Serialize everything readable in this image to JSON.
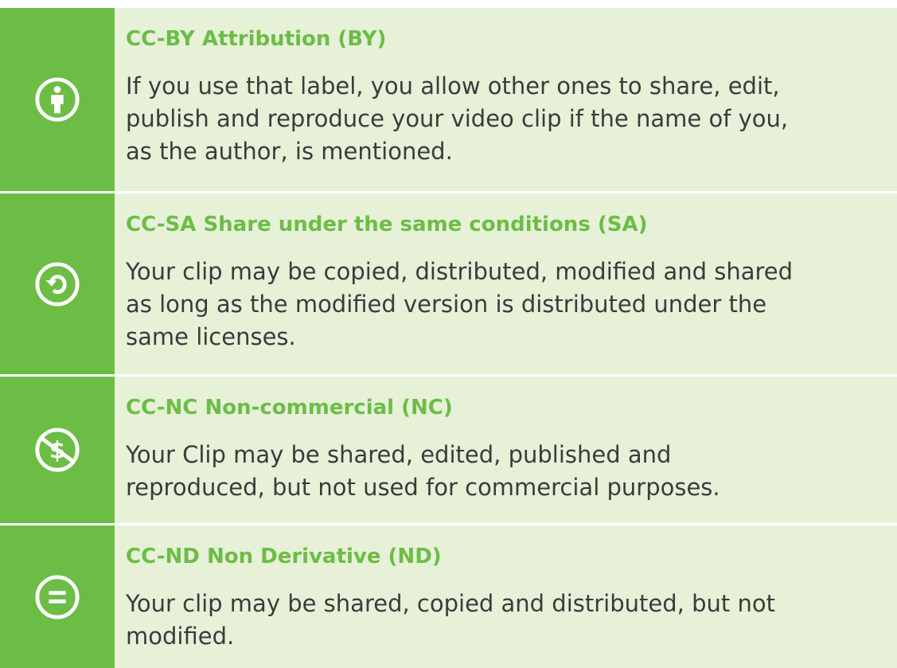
{
  "colors": {
    "accent": "#6cbd45",
    "panel_bg": "#e6f1d8",
    "text": "#3b3b3b"
  },
  "licenses": [
    {
      "icon": "person-icon",
      "title": "CC-BY Attribution (BY)",
      "lines": [
        "If you use that label, you allow other ones to share, edit,",
        "publish and reproduce your video clip if the name of you,",
        "as the author, is mentioned."
      ]
    },
    {
      "icon": "share-alike-icon",
      "title": "CC-SA Share under the same conditions (SA)",
      "lines": [
        "Your clip may be copied, distributed, modified and shared",
        "as long as the modified version is distributed under the",
        "same licenses."
      ]
    },
    {
      "icon": "non-commercial-icon",
      "title": "CC-NC Non-commercial (NC)",
      "lines": [
        "Your Clip may be shared, edited, published and",
        "reproduced, but not used for commercial purposes."
      ]
    },
    {
      "icon": "no-derivatives-icon",
      "title": "CC-ND Non Derivative (ND)",
      "lines": [
        "Your clip may be shared, copied and distributed, but not",
        "modified."
      ]
    }
  ]
}
